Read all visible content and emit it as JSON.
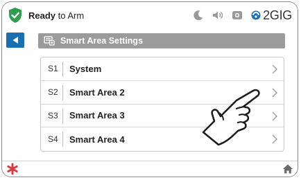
{
  "status": {
    "state_prefix": "Ready",
    "state_suffix": " to Arm",
    "shield_color": "#2e9e4f",
    "icons": [
      "moon-icon",
      "volume-icon",
      "camera-icon"
    ],
    "brand": "2GIG"
  },
  "header": {
    "back_icon": "back-arrow-icon",
    "title": "Smart Area Settings",
    "title_icon": "settings-screen-icon",
    "accent_color": "#1a6fb3",
    "title_bar_color": "#9b9b9b"
  },
  "list": {
    "items": [
      {
        "code": "S1",
        "label": "System"
      },
      {
        "code": "S2",
        "label": "Smart Area 2"
      },
      {
        "code": "S3",
        "label": "Smart Area 3"
      },
      {
        "code": "S4",
        "label": "Smart Area 4"
      }
    ]
  },
  "bottom": {
    "panic_icon": "panic-asterisk-icon",
    "panic_color": "#e0383e",
    "home_icon": "home-icon"
  }
}
